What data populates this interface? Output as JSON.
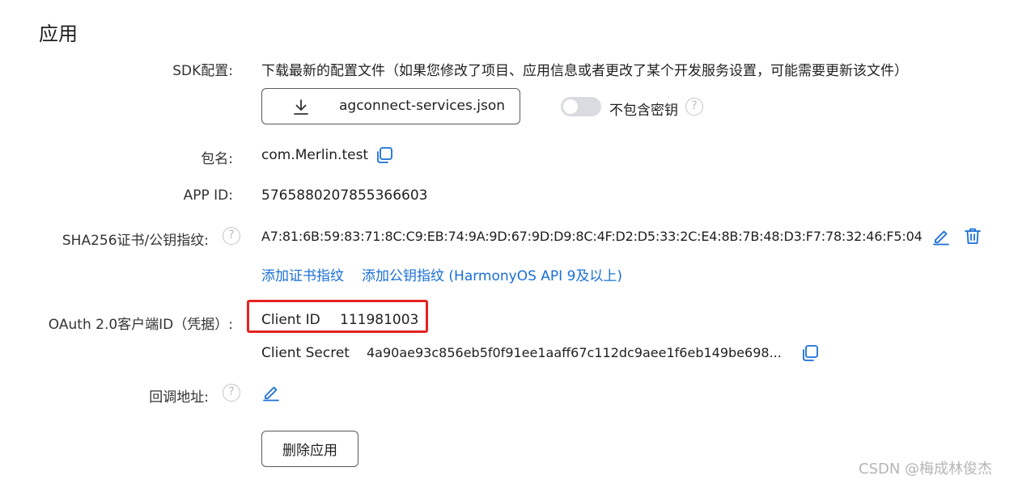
{
  "section_title": "应用",
  "sdk": {
    "label": "SDK配置:",
    "description": "下载最新的配置文件（如果您修改了项目、应用信息或者更改了某个开发服务设置，可能需要更新该文件）",
    "download_label": "agconnect-services.json",
    "toggle_label": "不包含密钥",
    "toggle_on": false
  },
  "package": {
    "label": "包名:",
    "value": "com.Merlin.test"
  },
  "app_id": {
    "label": "APP ID:",
    "value": "5765880207855366603"
  },
  "sha256": {
    "label": "SHA256证书/公钥指纹:",
    "value": "A7:81:6B:59:83:71:8C:C9:EB:74:9A:9D:67:9D:D9:8C:4F:D2:D5:33:2C:E4:8B:7B:48:D3:F7:78:32:46:F5:04",
    "add_cert_link": "添加证书指纹",
    "add_pubkey_link": "添加公钥指纹 (HarmonyOS API 9及以上)"
  },
  "oauth": {
    "label": "OAuth 2.0客户端ID（凭据）:",
    "client_id_label": "Client ID",
    "client_id_value": "111981003",
    "client_secret_label": "Client Secret",
    "client_secret_value": "4a90ae93c856eb5f0f91ee1aaff67c112dc9aee1f6eb149be698..."
  },
  "callback": {
    "label": "回调地址:"
  },
  "delete_button": "删除应用",
  "watermark": "CSDN @梅成林俊杰",
  "colors": {
    "link": "#1a6fd6",
    "highlight_box": "#e62222",
    "toggle_off": "#d9dbe0"
  },
  "icons": {
    "download": "download-icon",
    "help": "help-circle-icon",
    "copy": "copy-icon",
    "edit": "pencil-icon",
    "delete": "trash-icon"
  }
}
